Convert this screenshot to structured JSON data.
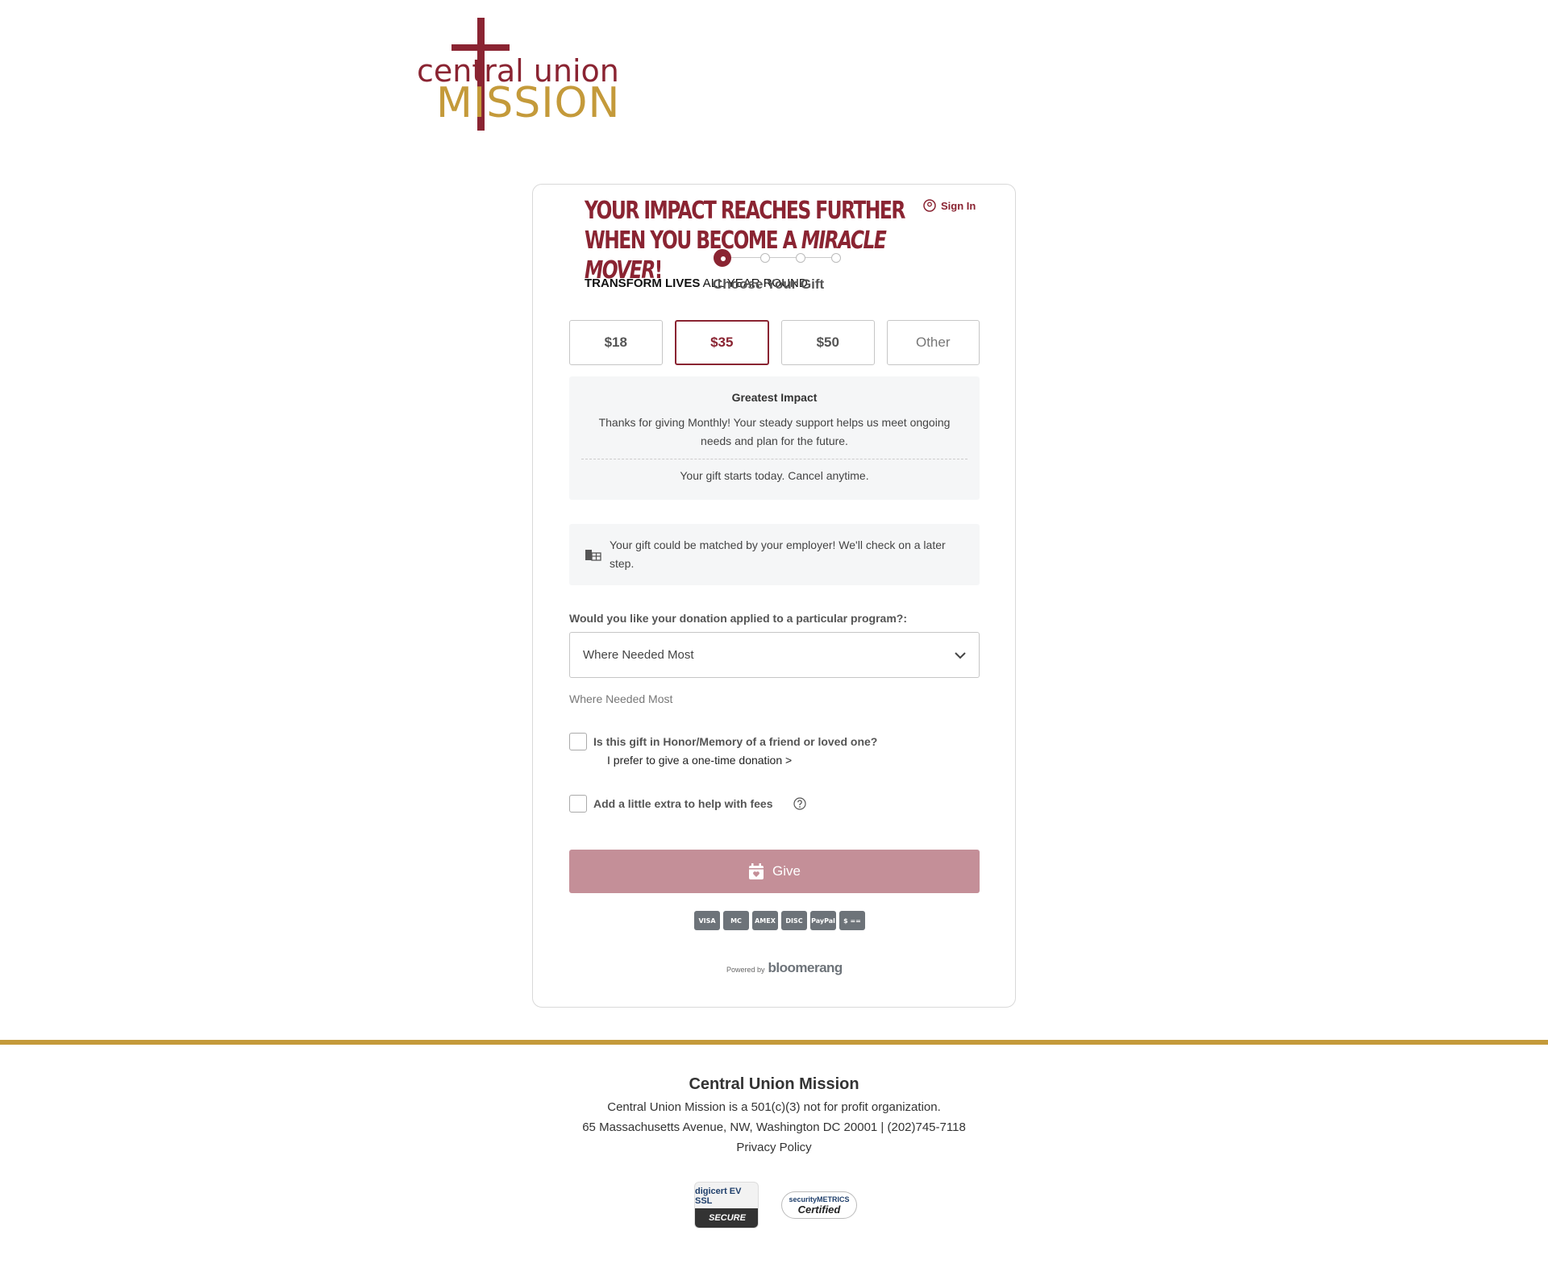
{
  "brand": {
    "logo_line1": "central union",
    "logo_line2": "MISSION",
    "primary_color": "#8a2432",
    "gold_color": "#c49a3a"
  },
  "form": {
    "headline_part1": "YOUR IMPACT REACHES FURTHER WHEN YOU BECOME A ",
    "headline_emphasis": "MIRACLE MOVER",
    "headline_end": "!",
    "sign_in_label": "Sign In",
    "transform_bold": "TRANSFORM LIVES",
    "transform_rest": " ALL YEAR ROUND",
    "step_title": "Choose Your Gift",
    "amounts": [
      "$18",
      "$35",
      "$50"
    ],
    "selected_amount": "$35",
    "other_placeholder": "Other",
    "impact_title": "Greatest Impact",
    "impact_description": "Thanks for giving Monthly! Your steady support helps us meet ongoing needs and plan for the future.",
    "impact_note": "Your gift starts today. Cancel anytime.",
    "match_text": "Your gift could be matched by your employer! We'll check on a later step.",
    "program_label": "Would you like your donation applied to a particular program?:",
    "program_selected": "Where Needed Most",
    "program_value_text": "Where Needed Most",
    "honor_label": "Is this gift in Honor/Memory of a friend or loved one?",
    "one_time_link": "I prefer to give a one-time donation >",
    "fees_label": "Add a little extra to help with fees",
    "give_label": "Give",
    "payment_methods": [
      "VISA",
      "MC",
      "AMEX",
      "DISC",
      "PayPal",
      "$ =="
    ],
    "powered_by": "Powered by",
    "powered_brand": "bloomerang"
  },
  "footer": {
    "org_name": "Central Union Mission",
    "tax_status": "Central Union Mission is a 501(c)(3) not for profit organization.",
    "address": "65 Massachusetts Avenue, NW, Washington DC 20001 | (202)745-7118",
    "privacy_link": "Privacy Policy",
    "badge_digicert_top": "digicert EV SSL",
    "badge_digicert_bottom": "SECURE",
    "badge_sm_top": "securityMETRICS",
    "badge_sm_bottom": "Certified"
  }
}
